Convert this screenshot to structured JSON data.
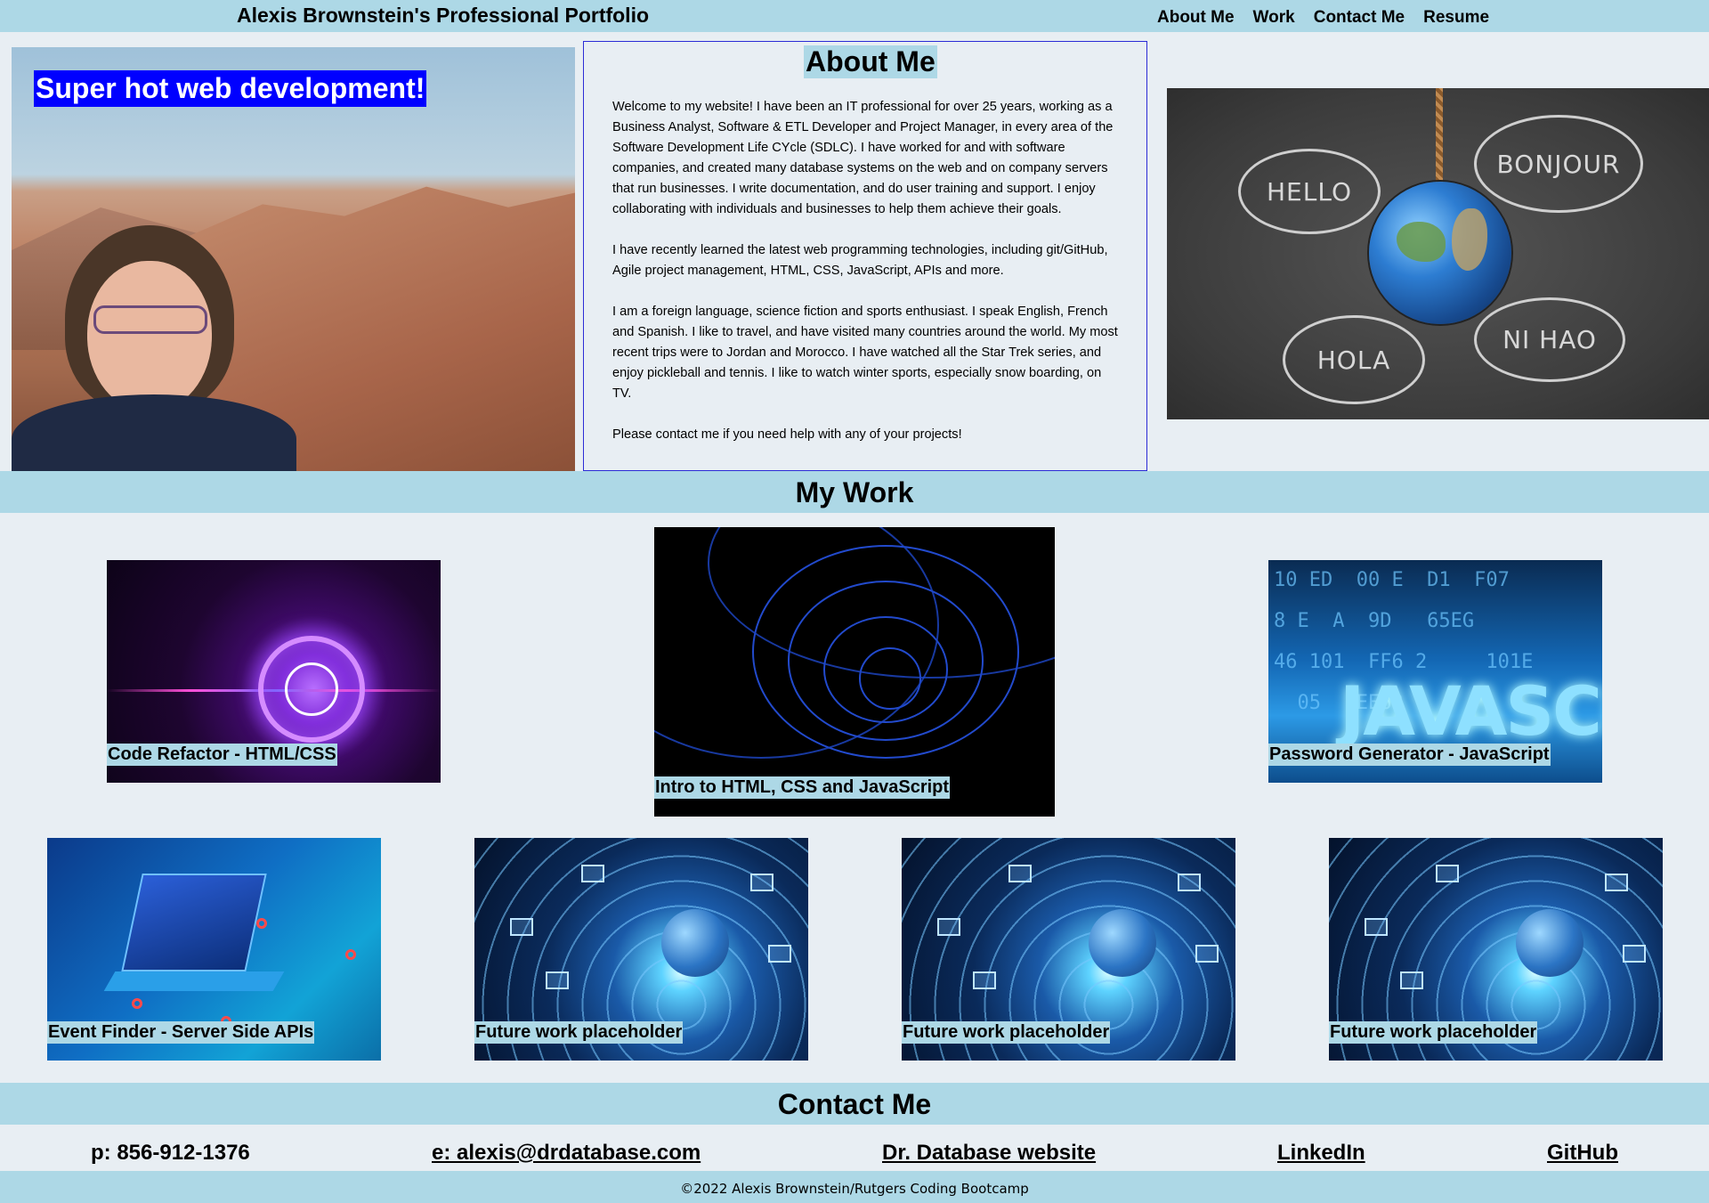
{
  "header": {
    "title": "Alexis Brownstein's Professional Portfolio",
    "nav": [
      "About Me",
      "Work",
      "Contact Me",
      "Resume"
    ]
  },
  "hero": {
    "caption": "Super hot web development!"
  },
  "about": {
    "title": "About Me",
    "paragraphs": [
      "Welcome to my website! I have been an IT professional for over 25 years, working as a Business Analyst, Software & ETL Developer and Project Manager, in every area of the Software Development Life CYcle (SDLC). I have worked for and with software companies, and created many database systems on the web and on company servers that run businesses. I write documentation, and do user training and support. I enjoy collaborating with individuals and businesses to help them achieve their goals.",
      "I have recently learned the latest web programming technologies, including git/GitHub, Agile project management, HTML, CSS, JavaScript, APIs and more.",
      "I am a foreign language, science fiction and sports enthusiast. I speak English, French and Spanish. I like to travel, and have visited many countries around the world. My most recent trips were to Jordan and Morocco. I have watched all the Star Trek series, and enjoy pickleball and tennis. I like to watch winter sports, especially snow boarding, on TV.",
      "Please contact me if you need help with any of your projects!"
    ]
  },
  "globe_image": {
    "greetings": [
      "HELLO",
      "BONJOUR",
      "HOLA",
      "NI HAO"
    ]
  },
  "work": {
    "title": "My Work",
    "projects": [
      "Code Refactor - HTML/CSS",
      "Intro to HTML, CSS and JavaScript",
      "Password Generator - JavaScript",
      "Event Finder - Server Side APIs",
      "Future work placeholder",
      "Future work placeholder",
      "Future work placeholder"
    ],
    "js_image_word": "JAVASCRI"
  },
  "contact": {
    "title": "Contact Me",
    "phone": "p: 856-912-1376",
    "email": "e: alexis@drdatabase.com",
    "website": "Dr. Database website",
    "linkedin": "LinkedIn",
    "github": "GitHub"
  },
  "footer": {
    "text": "©2022 Alexis Brownstein/Rutgers Coding Bootcamp"
  },
  "colors": {
    "band": "#add8e6",
    "page_bg": "#e8eef3",
    "caption_bg": "#0000ff",
    "about_border": "#2b2bd6"
  }
}
